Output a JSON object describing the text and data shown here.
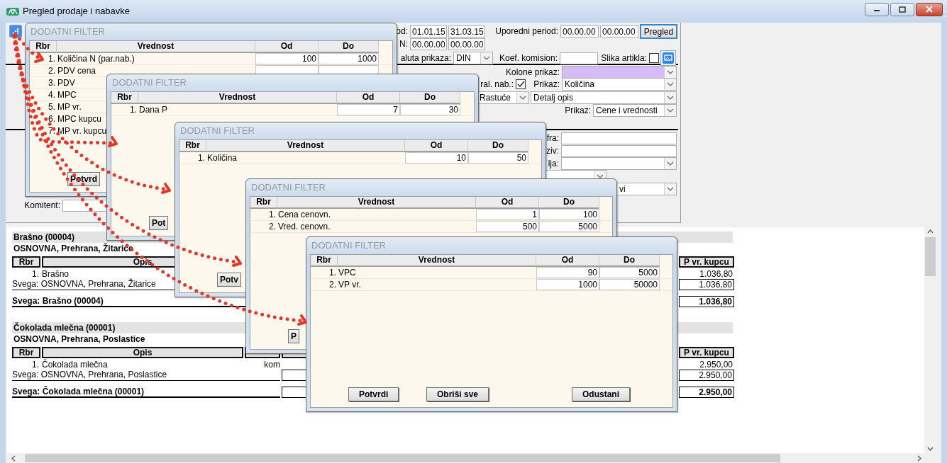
{
  "window": {
    "title": "Pregled prodaje i nabavke"
  },
  "form": {
    "rows": [
      {
        "items": [
          {
            "kind": "label",
            "text": "od:"
          },
          {
            "kind": "field",
            "value": "01.01.15"
          },
          {
            "kind": "field",
            "value": "31.03.15"
          },
          {
            "kind": "label",
            "text": "Uporedni period:"
          },
          {
            "kind": "field",
            "value": "00.00.00"
          },
          {
            "kind": "field",
            "value": "00.00.00"
          },
          {
            "kind": "button",
            "label": "Pregled",
            "focused": true
          }
        ]
      },
      {
        "items": [
          {
            "kind": "label",
            "text": "N:"
          },
          {
            "kind": "field",
            "value": "00.00.00"
          },
          {
            "kind": "field",
            "value": "00.00.00"
          }
        ]
      },
      {
        "items": [
          {
            "kind": "label",
            "text": "aluta prikaza:"
          },
          {
            "kind": "select",
            "value": "DIN",
            "highlighted": false
          },
          {
            "kind": "label",
            "text": "Koef. komision:"
          },
          {
            "kind": "field"
          },
          {
            "kind": "label",
            "text": "Slika artikla:"
          },
          {
            "kind": "checkbox",
            "checked": false
          },
          {
            "kind": "image-button"
          }
        ]
      },
      {
        "items": [
          {
            "kind": "label",
            "text": "Kolone prikaz:"
          },
          {
            "kind": "select",
            "highlighted": true
          }
        ]
      },
      {
        "items": [
          {
            "kind": "label",
            "text": "ral. nab.:"
          },
          {
            "kind": "checkbox",
            "checked": true
          },
          {
            "kind": "label",
            "text": "Prikaz:"
          },
          {
            "kind": "select",
            "value": "Količina",
            "highlighted": false
          }
        ]
      },
      {
        "items": [
          {
            "kind": "select",
            "value": "Rastuće",
            "highlighted": false
          },
          {
            "kind": "select",
            "value": "Detalj opis",
            "highlighted": false
          }
        ]
      },
      {
        "items": [
          {
            "kind": "label",
            "text": "Prikaz:"
          },
          {
            "kind": "select",
            "value": "Cene i vrednosti",
            "highlighted": false
          }
        ]
      },
      {
        "items": [
          {
            "kind": "label",
            "text": "fra:"
          },
          {
            "kind": "field"
          }
        ]
      },
      {
        "items": [
          {
            "kind": "label",
            "text": "ziv:"
          },
          {
            "kind": "field"
          }
        ]
      },
      {
        "items": [
          {
            "kind": "label",
            "text": "lja:"
          },
          {
            "kind": "select",
            "highlighted": false
          }
        ]
      },
      {
        "items": [
          {
            "kind": "select",
            "highlighted": false
          }
        ]
      },
      {
        "items": [
          {
            "kind": "select",
            "value": "vi",
            "highlighted": false
          }
        ]
      },
      {
        "items": [
          {
            "kind": "label",
            "text": "Komitent:"
          },
          {
            "kind": "field"
          }
        ]
      }
    ]
  },
  "report": {
    "groups": [
      {
        "title": "Brašno (00004)",
        "category": "OSNOVNA, Prehrana, Žitarice",
        "columns": [
          "Rbr",
          "Opis",
          "P vr. kupcu"
        ],
        "items": [
          {
            "number": "1.",
            "name": "Brašno",
            "value": "1.036,80"
          }
        ],
        "subtotal": {
          "label": "Svega: OSNOVNA, Prehrana, Žitarice",
          "value": "1.036,80"
        },
        "total": {
          "label": "Svega: Brašno (00004)",
          "value": "1.036,80"
        }
      },
      {
        "title": "Čokolada mlečna (00001)",
        "category": "OSNOVNA, Prehrana, Poslastice",
        "columns": [
          "Rbr",
          "Opis",
          "P vr. kupcu"
        ],
        "items": [
          {
            "number": "1.",
            "name": "Čokolada mlečna",
            "unit": "kom",
            "value": "2.950,00"
          }
        ],
        "subtotal": {
          "label": "Svega: OSNOVNA, Prehrana, Poslastice",
          "value": "2.950,00"
        },
        "total": {
          "label": "Svega: Čokolada mlečna (00001)",
          "value": "2.950,00"
        }
      }
    ]
  },
  "dialogs": [
    {
      "title": "DODATNI FILTER",
      "columns": [
        "Rbr",
        "Vrednost",
        "Od",
        "Do"
      ],
      "filters": [
        {
          "number": "1.",
          "name": "Količina N (par.nab.)",
          "from": "100",
          "to": "1000"
        },
        {
          "number": "2.",
          "name": "PDV cena"
        },
        {
          "number": "3.",
          "name": "PDV"
        },
        {
          "number": "4.",
          "name": "MPC"
        },
        {
          "number": "5.",
          "name": "MP vr."
        },
        {
          "number": "6.",
          "name": "MPC kupcu"
        },
        {
          "number": "7.",
          "name": "MP vr. kupcu"
        }
      ],
      "buttons": [
        "Potvrd"
      ]
    },
    {
      "title": "DODATNI FILTER",
      "columns": [
        "Rbr",
        "Vrednost",
        "Od",
        "Do"
      ],
      "filters": [
        {
          "number": "1.",
          "name": "Dana P",
          "from": "7",
          "to": "30"
        }
      ],
      "buttons": [
        "Pot"
      ]
    },
    {
      "title": "DODATNI FILTER",
      "columns": [
        "Rbr",
        "Vrednost",
        "Od",
        "Do"
      ],
      "filters": [
        {
          "number": "1.",
          "name": "Količina",
          "from": "10",
          "to": "50"
        }
      ],
      "buttons": [
        "Potv"
      ]
    },
    {
      "title": "DODATNI FILTER",
      "columns": [
        "Rbr",
        "Vrednost",
        "Od",
        "Do"
      ],
      "filters": [
        {
          "number": "1.",
          "name": "Cena cenovn.",
          "from": "1",
          "to": "100"
        },
        {
          "number": "2.",
          "name": "Vred. cenovn.",
          "from": "500",
          "to": "5000"
        }
      ],
      "buttons": [
        "P"
      ]
    },
    {
      "title": "DODATNI FILTER",
      "columns": [
        "Rbr",
        "Vrednost",
        "Od",
        "Do"
      ],
      "filters": [
        {
          "number": "1.",
          "name": "VPC",
          "from": "90",
          "to": "5000"
        },
        {
          "number": "2.",
          "name": "VP vr.",
          "from": "1000",
          "to": "50000"
        }
      ],
      "buttons": [
        "Potvrdi",
        "Obriši sve",
        "Odustani"
      ]
    }
  ]
}
